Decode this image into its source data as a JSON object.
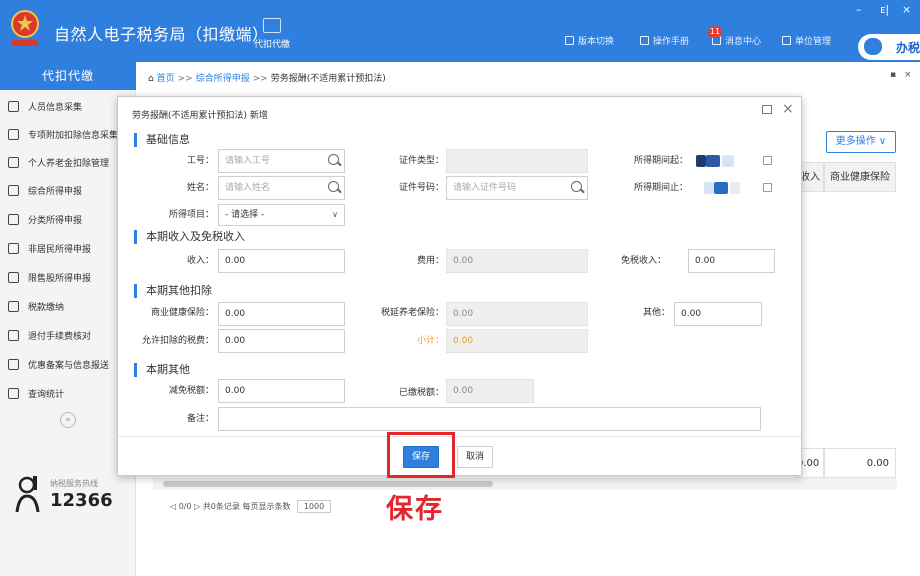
{
  "app": {
    "title": "自然人电子税务局（扣缴端）",
    "toolbar_dai_kou": "代扣代缴",
    "links": [
      "版本切换",
      "操作手册",
      "消息中心",
      "单位管理"
    ],
    "message_badge": "11",
    "side_pill": "办税",
    "win_controls": [
      "–",
      "ᴇ|",
      "×"
    ]
  },
  "nav": {
    "header": "代扣代缴",
    "items": [
      {
        "label": "人员信息采集",
        "icon": "person-icon"
      },
      {
        "label": "专项附加扣除信息采集",
        "icon": "list-icon"
      },
      {
        "label": "个人养老金扣除管理",
        "icon": "pension-icon"
      },
      {
        "label": "综合所得申报",
        "icon": "layers-icon"
      },
      {
        "label": "分类所得申报",
        "icon": "pie-icon"
      },
      {
        "label": "非居民所得申报",
        "icon": "person-add-icon"
      },
      {
        "label": "限售股所得申报",
        "icon": "bar-chart-icon"
      },
      {
        "label": "税款缴纳",
        "icon": "wallet-icon"
      },
      {
        "label": "退付手续费核对",
        "icon": "receipt-icon"
      },
      {
        "label": "优惠备案与信息报送",
        "icon": "doc-icon"
      },
      {
        "label": "查询统计",
        "icon": "query-icon"
      }
    ],
    "collapse": "«",
    "hotline_label": "纳税服务热线",
    "hotline_number": "12366"
  },
  "main": {
    "breadcrumb": {
      "home": "首页",
      "level1": "综合所得申报",
      "level2": "劳务报酬(不适用累计预扣法)",
      "sep": ">>"
    },
    "ctrl": [
      "▪",
      "×"
    ],
    "more_ops": "更多操作 ∨",
    "col_heads": [
      "收入",
      "商业健康保险"
    ],
    "totals": [
      "0.00",
      "0.00"
    ],
    "pager": {
      "text": "◁ 0/0 ▷ 共0条记录  每页显示条数",
      "size": "1000"
    }
  },
  "modal": {
    "title": "劳务报酬(不适用累计预扣法) 新增",
    "sections": {
      "basic": "基础信息",
      "income": "本期收入及免税收入",
      "deduction": "本期其他扣除",
      "other": "本期其他"
    },
    "fields": {
      "work_id": {
        "label": "工号：",
        "placeholder": "请输入工号"
      },
      "id_type": {
        "label": "证件类型：",
        "value": ""
      },
      "period_start": {
        "label": "所得期间起："
      },
      "name": {
        "label": "姓名：",
        "placeholder": "请输入姓名"
      },
      "id_number": {
        "label": "证件号码：",
        "placeholder": "请输入证件号码"
      },
      "period_end": {
        "label": "所得期间止："
      },
      "income_item": {
        "label": "所得项目：",
        "value": "- 请选择 -"
      },
      "income": {
        "label": "收入：",
        "value": "0.00"
      },
      "expense": {
        "label": "费用：",
        "value": "0.00"
      },
      "tax_free_income": {
        "label": "免税收入：",
        "value": "0.00"
      },
      "health_insurance": {
        "label": "商业健康保险：",
        "value": "0.00"
      },
      "deferred_pension": {
        "label": "税延养老保险：",
        "value": "0.00"
      },
      "other": {
        "label": "其他：",
        "value": "0.00"
      },
      "allowed_tax_deduction": {
        "label": "允许扣除的税费：",
        "value": "0.00"
      },
      "subtotal": {
        "label": "小计：",
        "value": "0.00"
      },
      "tax_reduction": {
        "label": "减免税额：",
        "value": "0.00"
      },
      "tax_paid": {
        "label": "已缴税额：",
        "value": "0.00"
      },
      "remark": {
        "label": "备注：",
        "value": ""
      }
    },
    "buttons": {
      "save": "保存",
      "cancel": "取消"
    }
  },
  "annotation": "保存",
  "colors": {
    "accent": "#2f7fde",
    "highlight": "#e3262d",
    "subtotal": "#e89a2c"
  }
}
